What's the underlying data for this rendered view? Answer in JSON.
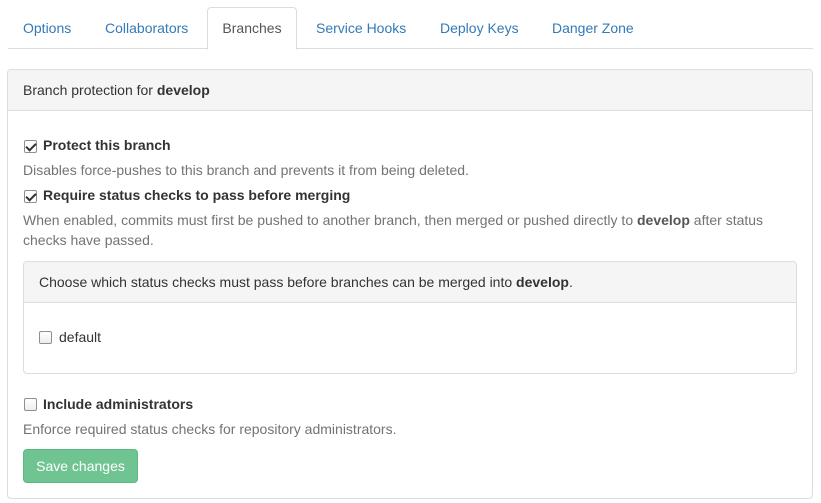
{
  "tabs": [
    {
      "label": "Options"
    },
    {
      "label": "Collaborators"
    },
    {
      "label": "Branches",
      "active": true
    },
    {
      "label": "Service Hooks"
    },
    {
      "label": "Deploy Keys"
    },
    {
      "label": "Danger Zone"
    }
  ],
  "panel": {
    "heading_prefix": "Branch protection for ",
    "branch": "develop"
  },
  "protect": {
    "checked": true,
    "label": "Protect this branch",
    "help": "Disables force-pushes to this branch and prevents it from being deleted."
  },
  "status_checks": {
    "checked": true,
    "label": "Require status checks to pass before merging",
    "help_line1_prefix": "When enabled, commits must first be pushed to another branch, then merged or pushed directly to ",
    "help_line1_branch": "develop",
    "help_line1_suffix": " after status",
    "help_line2": "checks have passed.",
    "choose_prefix": "Choose which status checks must pass before branches can be merged into ",
    "choose_branch": "develop",
    "choose_suffix": ".",
    "options": [
      {
        "label": "default",
        "checked": false
      }
    ]
  },
  "admins": {
    "checked": false,
    "label": "Include administrators",
    "help": "Enforce required status checks for repository administrators."
  },
  "save_button": "Save changes",
  "colors": {
    "link": "#337ab7",
    "button": "#6fc492",
    "border": "#dddddd",
    "heading_bg": "#f5f5f5"
  }
}
